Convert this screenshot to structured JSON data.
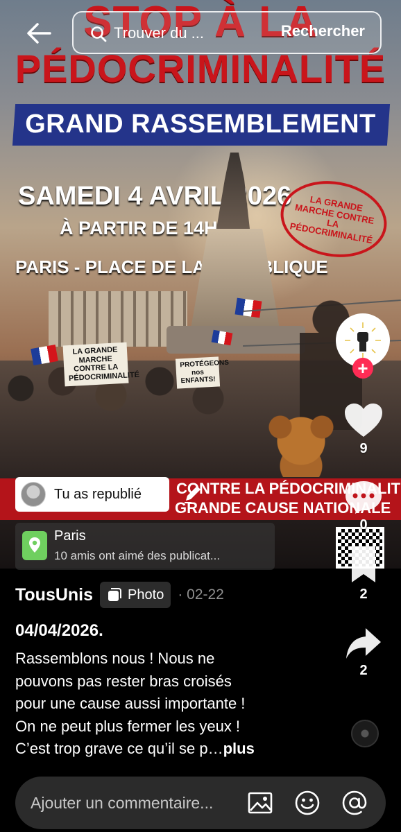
{
  "poster": {
    "headline_line1": "STOP À LA",
    "headline_line2": "PÉDOCRIMINALITÉ",
    "banner": "GRAND RASSEMBLEMENT",
    "date": "SAMEDI 4 AVRIL 2026",
    "time": "À PARTIR DE 14H",
    "place": "PARIS - PLACE DE LA RÉPUBLIQUE",
    "stamp_text": "LA GRANDE MARCHE CONTRE LA PÉDOCRIMINALITÉ",
    "sign1": "LA GRANDE MARCHE CONTRE LA PÉDOCRIMINALITÉ",
    "sign2": "PROTÉGEONS nos ENFANTS!",
    "bottom_line1": "CONTRE LA PÉDOCRIMINALITÉ",
    "bottom_line2": "GRANDE CAUSE NATIONALE"
  },
  "search": {
    "placeholder": "Trouver du ...",
    "button_label": "Rechercher"
  },
  "actions": {
    "likes": "9",
    "comments": "0",
    "saves": "2",
    "shares": "2"
  },
  "repost": {
    "label": "Tu as republié"
  },
  "location": {
    "title": "Paris",
    "subtitle": "10 amis ont aimé des publicat..."
  },
  "post": {
    "author": "TousUnis",
    "type_badge": "Photo",
    "date": "· 02-22",
    "caption_title": "04/04/2026.",
    "caption_lines": [
      "Rassemblons nous ! Nous ne",
      "pouvons pas rester bras croisés",
      "pour une cause aussi importante !",
      "On ne peut plus fermer les yeux !",
      "C’est trop grave ce qu’il se p…"
    ],
    "more_label": "plus"
  },
  "comment_bar": {
    "placeholder": "Ajouter un commentaire..."
  },
  "colors": {
    "accent_red": "#fe2c55",
    "poster_red": "#c9151b",
    "banner_blue": "#24348a"
  }
}
